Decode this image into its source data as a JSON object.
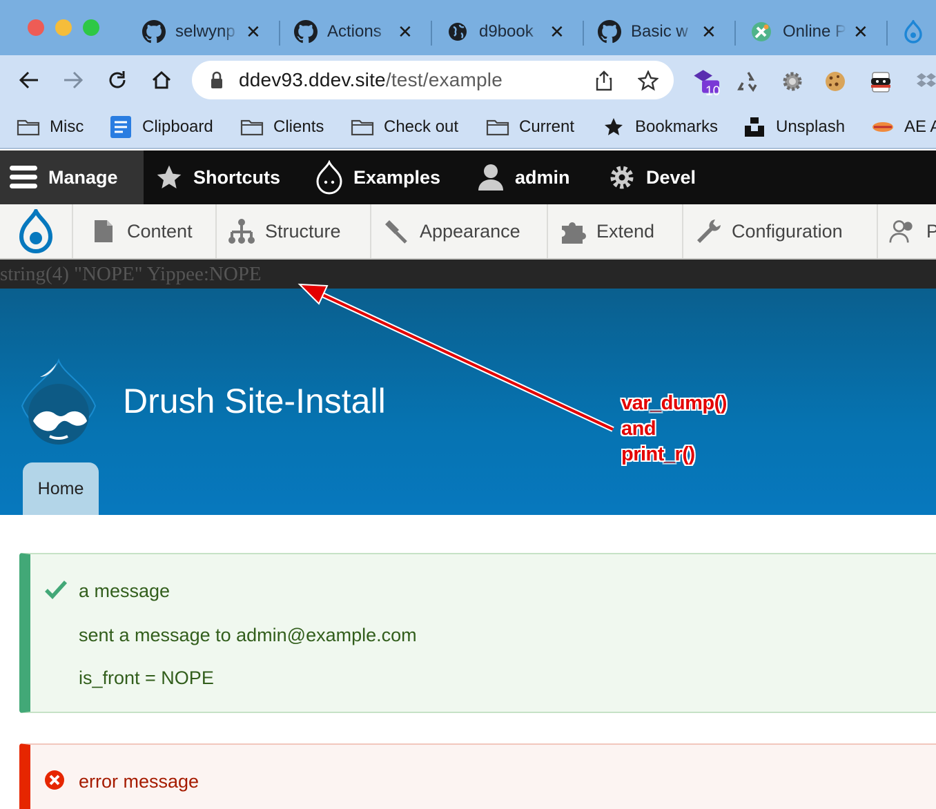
{
  "browser": {
    "tabs": [
      {
        "label": "selwynp",
        "icon": "github-icon"
      },
      {
        "label": "Actions",
        "icon": "github-icon"
      },
      {
        "label": "d9book",
        "icon": "globe-icon"
      },
      {
        "label": "Basic w",
        "icon": "github-icon"
      },
      {
        "label": "Online P",
        "icon": "tools-icon"
      }
    ],
    "address": {
      "host": "ddev93.ddev.site",
      "path": "/test/example"
    },
    "extension_badge": "10",
    "bookmarks": [
      {
        "label": "Misc",
        "icon": "folder-icon"
      },
      {
        "label": "Clipboard",
        "icon": "doc-icon"
      },
      {
        "label": "Clients",
        "icon": "folder-icon"
      },
      {
        "label": "Check out",
        "icon": "folder-icon"
      },
      {
        "label": "Current",
        "icon": "folder-icon"
      },
      {
        "label": "Bookmarks",
        "icon": "star-icon"
      },
      {
        "label": "Unsplash",
        "icon": "unsplash-icon"
      },
      {
        "label": "AE A",
        "icon": "ae-icon"
      }
    ]
  },
  "admin_toolbar": {
    "items": [
      "Manage",
      "Shortcuts",
      "Examples",
      "admin",
      "Devel"
    ],
    "tray": [
      "Content",
      "Structure",
      "Appearance",
      "Extend",
      "Configuration",
      "P"
    ]
  },
  "debug_output": "string(4) \"NOPE\" Yippee:NOPE",
  "site": {
    "name": "Drush Site-Install",
    "home_tab": "Home"
  },
  "annotation": {
    "lines": [
      "var_dump()",
      "and",
      "print_r()"
    ],
    "color": "#e30000"
  },
  "messages": {
    "status": [
      "a message",
      "sent a message to admin@example.com",
      "is_front = NOPE"
    ],
    "error": [
      "error message"
    ]
  }
}
